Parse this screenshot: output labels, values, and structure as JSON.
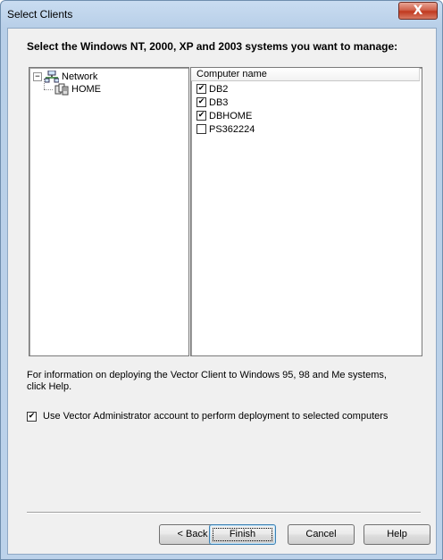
{
  "window": {
    "title": "Select Clients",
    "close_glyph": "X"
  },
  "heading": "Select the Windows NT, 2000, XP and 2003 systems you want to manage:",
  "tree": {
    "root": {
      "label": "Network",
      "expander": "−",
      "icon": "network-icon"
    },
    "child": {
      "label": "HOME",
      "icon": "workgroup-icon"
    }
  },
  "list": {
    "column_header": "Computer name",
    "items": [
      {
        "name": "DB2",
        "checked": true
      },
      {
        "name": "DB3",
        "checked": true
      },
      {
        "name": "DBHOME",
        "checked": true
      },
      {
        "name": "PS362224",
        "checked": false
      }
    ]
  },
  "info_text": "For information on deploying the Vector Client to Windows 95, 98 and Me systems, click Help.",
  "option": {
    "label": "Use Vector Administrator account to perform deployment to selected computers",
    "checked": true
  },
  "buttons": {
    "back": "< Back",
    "finish": "Finish",
    "cancel": "Cancel",
    "help": "Help"
  }
}
